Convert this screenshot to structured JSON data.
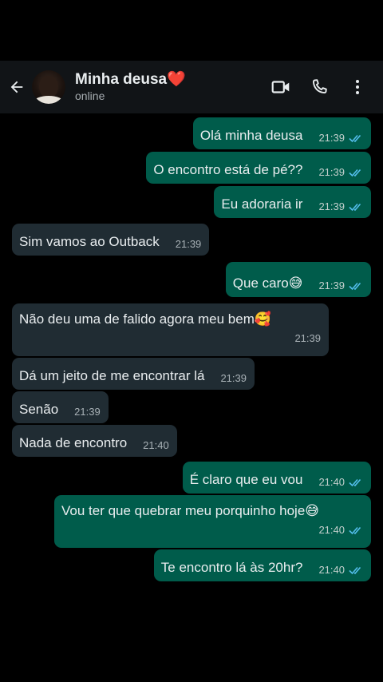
{
  "header": {
    "contact_name": "Minha deusa❤️",
    "status": "online",
    "icons": [
      "back-arrow-icon",
      "video-call-icon",
      "voice-call-icon",
      "more-options-icon"
    ]
  },
  "colors": {
    "outgoing_bubble": "#005c4b",
    "incoming_bubble": "#202c33",
    "read_ticks": "#53bdeb",
    "background": "#000000"
  },
  "messages": [
    {
      "direction": "out",
      "text": "Olá minha deusa",
      "time": "21:39",
      "status": "read"
    },
    {
      "direction": "out",
      "text": "O encontro está de pé??",
      "time": "21:39",
      "status": "read"
    },
    {
      "direction": "out",
      "text": "Eu adoraria ir",
      "time": "21:39",
      "status": "read"
    },
    {
      "direction": "in",
      "text": "Sim vamos ao Outback",
      "time": "21:39"
    },
    {
      "direction": "out",
      "text": "Que caro😅",
      "time": "21:39",
      "status": "read"
    },
    {
      "direction": "in",
      "text": "Não deu uma de falido agora meu bem🥰",
      "time": "21:39"
    },
    {
      "direction": "in",
      "text": "Dá um jeito de me encontrar lá",
      "time": "21:39"
    },
    {
      "direction": "in",
      "text": "Senão",
      "time": "21:39"
    },
    {
      "direction": "in",
      "text": "Nada de encontro",
      "time": "21:40"
    },
    {
      "direction": "out",
      "text": "É claro que eu vou",
      "time": "21:40",
      "status": "read"
    },
    {
      "direction": "out",
      "text": "Vou ter que quebrar meu porquinho hoje😅",
      "time": "21:40",
      "status": "read"
    },
    {
      "direction": "out",
      "text": "Te encontro lá às 20hr?",
      "time": "21:40",
      "status": "read"
    }
  ]
}
